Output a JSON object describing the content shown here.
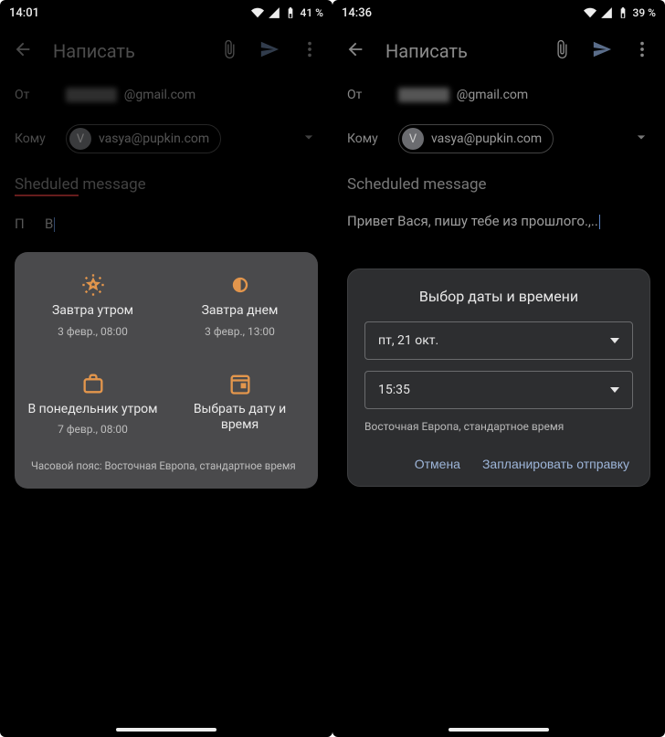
{
  "left": {
    "status": {
      "time": "14:01",
      "battery": "41 %"
    },
    "toolbar": {
      "title": "Написать"
    },
    "from_label": "От",
    "from_value": "@gmail.com",
    "to_label": "Кому",
    "to_chip": {
      "avatar": "V",
      "email": "vasya@pupkin.com"
    },
    "subject_misspelled_part": "Sheduled",
    "subject_rest": " message",
    "body_prefix": "П",
    "body_rest": "В",
    "schedule": {
      "options": [
        {
          "name": "Завтра утром",
          "sub": "3 февр., 08:00",
          "icon": "sun"
        },
        {
          "name": "Завтра днем",
          "sub": "3 февр., 13:00",
          "icon": "half-sun"
        },
        {
          "name": "В понедельник утром",
          "sub": "7 февр., 08:00",
          "icon": "briefcase"
        },
        {
          "name": "Выбрать дату и время",
          "sub": "",
          "icon": "calendar"
        }
      ],
      "tz_note": "Часовой пояс: Восточная Европа, стандартное время"
    }
  },
  "right": {
    "status": {
      "time": "14:36",
      "battery": "39 %"
    },
    "toolbar": {
      "title": "Написать"
    },
    "from_label": "От",
    "from_value": "@gmail.com",
    "to_label": "Кому",
    "to_chip": {
      "avatar": "V",
      "email": "vasya@pupkin.com"
    },
    "subject": "Scheduled message",
    "body": "Привет Вася, пишу тебе из прошлого.,..",
    "picker": {
      "title": "Выбор даты и времени",
      "date": "пт, 21 окт.",
      "time": "15:35",
      "tz": "Восточная Европа, стандартное время",
      "cancel": "Отмена",
      "confirm": "Запланировать отправку"
    }
  }
}
